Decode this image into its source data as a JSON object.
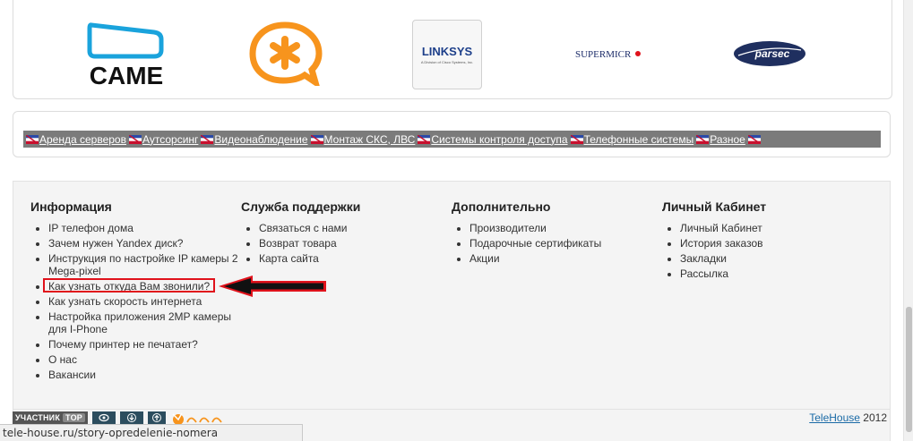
{
  "brands": {
    "came": "CAME",
    "linksys": "LINKSYS",
    "linksys_sub": "A Division of Cisco Systems, Inc.",
    "supermicro": "SUPERMICR",
    "parsec": "parsec"
  },
  "menu": {
    "items": [
      "Аренда серверов",
      "Аутсорсинг",
      "Видеонаблюдение",
      "Монтаж СКС, ЛВС",
      "Системы контроля доступа",
      "Телефонные системы",
      "Разное"
    ]
  },
  "footer": {
    "info": {
      "title": "Информация",
      "items": [
        "IP телефон дома",
        "Зачем нужен Yandex диск?",
        "Инструкция по настройке IP камеры 2 Mega-pixel",
        "Как узнать откуда Вам звонили?",
        "Как узнать скорость интернета",
        "Настройка приложения 2MP камеры для I-Phone",
        "Почему принтер не печатает?",
        "О нас",
        "Вакансии"
      ]
    },
    "support": {
      "title": "Служба поддержки",
      "items": [
        "Связаться с нами",
        "Возврат товара",
        "Карта сайта"
      ]
    },
    "extra": {
      "title": "Дополнительно",
      "items": [
        "Производители",
        "Подарочные сертификаты",
        "Акции"
      ]
    },
    "account": {
      "title": "Личный Кабинет",
      "items": [
        "Личный Кабинет",
        "История заказов",
        "Закладки",
        "Рассылка"
      ]
    }
  },
  "widgets": {
    "counter_label": "УЧАСТНИК",
    "counter_top": "TOP"
  },
  "copyright": {
    "site": "TeleHouse",
    "year": "2012"
  },
  "status_url": "tele-house.ru/story-opredelenie-nomera",
  "colors": {
    "menu_bg": "#7b7b7b",
    "highlight": "#e0121b",
    "asterisk_orange": "#f7941d",
    "came_blue": "#1aa3dc",
    "parsec_navy": "#1f2f5f"
  }
}
